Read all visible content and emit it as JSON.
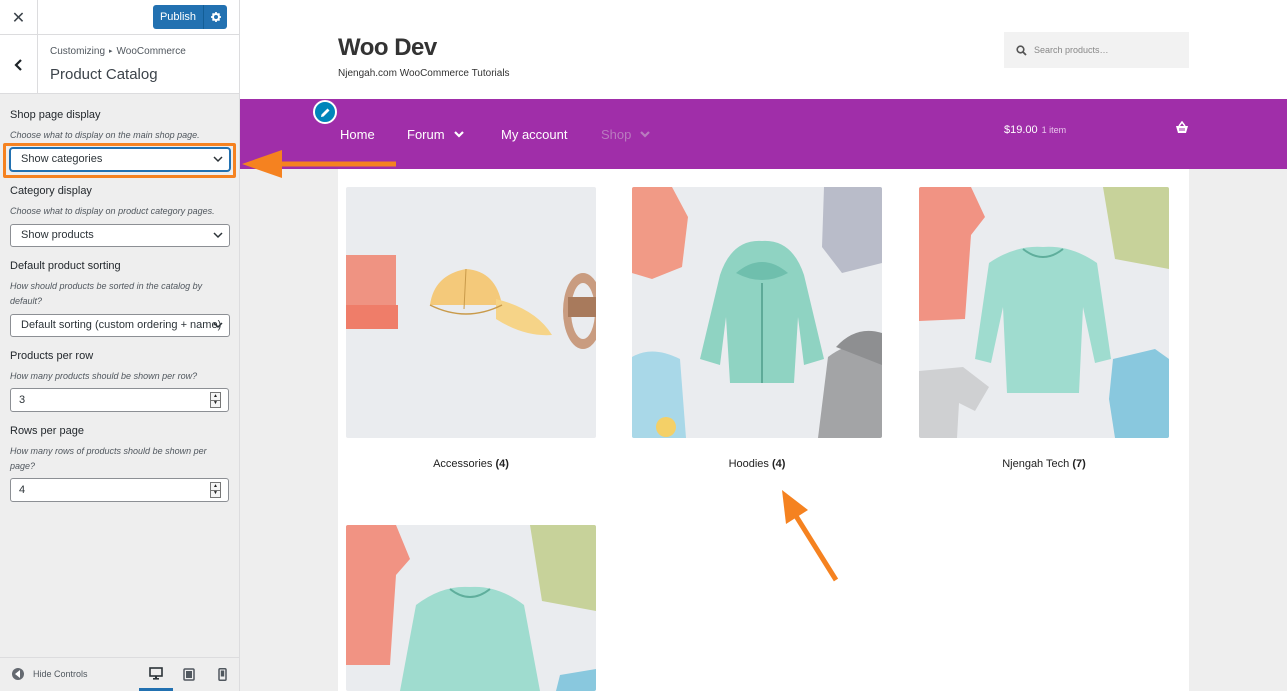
{
  "customizer": {
    "publish_label": "Publish",
    "breadcrumb": {
      "root": "Customizing",
      "section": "WooCommerce"
    },
    "section_title": "Product Catalog",
    "controls": {
      "shop_page_display": {
        "label": "Shop page display",
        "description": "Choose what to display on the main shop page.",
        "value": "Show categories"
      },
      "category_display": {
        "label": "Category display",
        "description": "Choose what to display on product category pages.",
        "value": "Show products"
      },
      "default_sorting": {
        "label": "Default product sorting",
        "description": "How should products be sorted in the catalog by default?",
        "value": "Default sorting (custom ordering + name)"
      },
      "products_per_row": {
        "label": "Products per row",
        "description": "How many products should be shown per row?",
        "value": "3"
      },
      "rows_per_page": {
        "label": "Rows per page",
        "description": "How many rows of products should be shown per page?",
        "value": "4"
      }
    },
    "footer": {
      "hide_controls_label": "Hide Controls",
      "active_device": "desktop"
    }
  },
  "site": {
    "title": "Woo Dev",
    "tagline": "Njengah.com WooCommerce Tutorials",
    "search_placeholder": "Search products…",
    "nav": {
      "items": [
        {
          "label": "Home"
        },
        {
          "label": "Forum"
        },
        {
          "label": "My account"
        },
        {
          "label": "Shop"
        }
      ],
      "cart_total": "$19.00",
      "cart_count": "1 item"
    },
    "categories": [
      {
        "name": "Accessories",
        "count": "(4)"
      },
      {
        "name": "Hoodies",
        "count": "(4)"
      },
      {
        "name": "Njengah Tech",
        "count": "(7)"
      }
    ]
  },
  "colors": {
    "nav_background": "#a02ea9",
    "publish_blue": "#2271b1",
    "annotation_orange": "#f58220"
  },
  "icons": [
    "close-icon",
    "gear-icon",
    "chevron-left-icon",
    "chevron-down-icon",
    "search-icon",
    "pencil-icon",
    "basket-icon",
    "desktop-icon",
    "tablet-icon",
    "mobile-icon"
  ]
}
